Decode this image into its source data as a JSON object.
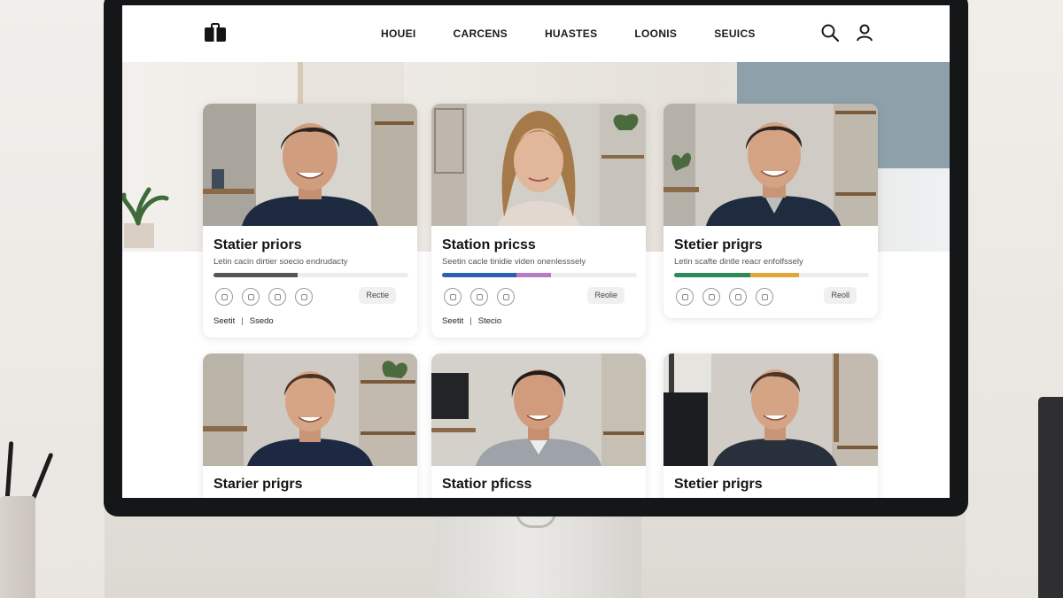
{
  "nav": {
    "links": [
      "HOUEI",
      "CARCENS",
      "HUASTES",
      "LOONIS",
      "SEUICS"
    ],
    "icons": [
      "search-icon",
      "user-icon"
    ]
  },
  "cards": [
    {
      "title": "Statier priors",
      "subtitle": "Letin cacin dirtier soecio endrudacty",
      "progress": [
        {
          "color": "#555555",
          "fraction": 0.43
        }
      ],
      "icon_names": [
        "instagram-icon",
        "camera-icon",
        "camera-icon",
        "bird-icon"
      ],
      "badge": "Rectie",
      "footer": [
        "Seetit",
        "Ssedo"
      ]
    },
    {
      "title": "Station pricss",
      "subtitle": "Seetin cacle tinidie viden onenlesssely",
      "progress": [
        {
          "color": "#2f5fb0",
          "fraction": 0.38
        },
        {
          "color": "#b87bc6",
          "fraction": 0.18
        }
      ],
      "icon_names": [
        "instagram-icon",
        "camera-icon",
        "camera-icon"
      ],
      "badge": "Reolie",
      "footer": [
        "Seetit",
        "Stecio"
      ]
    },
    {
      "title": "Stetier prigrs",
      "subtitle": "Letin scafte dintle reacr enfolfssely",
      "progress": [
        {
          "color": "#2e8a5a",
          "fraction": 0.39
        },
        {
          "color": "#e2a73a",
          "fraction": 0.25
        }
      ],
      "icon_names": [
        "instagram-icon",
        "camera-icon",
        "camera-icon",
        "bird-icon"
      ],
      "badge": "Reoll"
    },
    {
      "title": "Starier prigrs"
    },
    {
      "title": "Statior pficss"
    },
    {
      "title": "Stetier prigrs"
    }
  ],
  "colors": {
    "bezel": "#151618",
    "accent_blue": "#2f5fb0",
    "accent_green": "#2e8a5a",
    "accent_orange": "#e2a73a",
    "accent_pink": "#b87bc6"
  }
}
